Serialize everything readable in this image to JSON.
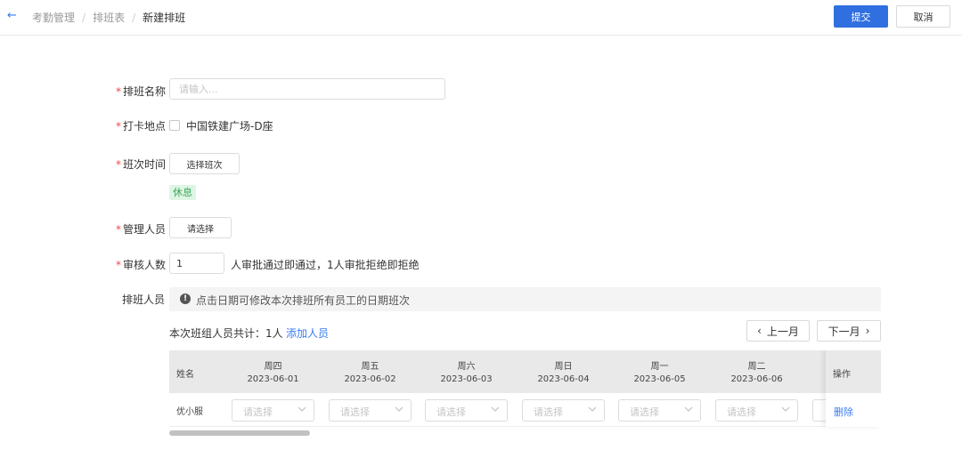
{
  "header": {
    "back_icon": "arrow-left-icon",
    "breadcrumb": [
      "考勤管理",
      "排班表",
      "新建排班"
    ],
    "separator": "/",
    "submit_label": "提交",
    "cancel_label": "取消",
    "accent": "#2f6fe0"
  },
  "form": {
    "required_mark": "*",
    "name": {
      "label": "排班名称",
      "placeholder": "请输入..."
    },
    "location": {
      "label": "打卡地点",
      "option": "中国铁建广场-D座",
      "checked": false
    },
    "shift_time": {
      "label": "班次时间",
      "button": "选择班次",
      "tag": "休息"
    },
    "manager": {
      "label": "管理人员",
      "button": "请选择"
    },
    "reviewers": {
      "label": "审核人数",
      "value": "1",
      "suffix": "人审批通过即通过，1人审批拒绝即拒绝"
    },
    "staff": {
      "label": "排班人员",
      "notice": "点击日期可修改本次排班所有员工的日期班次",
      "count_text": "本次班组人员共计：1人",
      "add_link": "添加人员",
      "prev_month": "上一月",
      "next_month": "下一月"
    }
  },
  "table": {
    "name_header": "姓名",
    "op_header": "操作",
    "days": [
      {
        "weekday": "周四",
        "date": "2023-06-01"
      },
      {
        "weekday": "周五",
        "date": "2023-06-02"
      },
      {
        "weekday": "周六",
        "date": "2023-06-03"
      },
      {
        "weekday": "周日",
        "date": "2023-06-04"
      },
      {
        "weekday": "周一",
        "date": "2023-06-05"
      },
      {
        "weekday": "周二",
        "date": "2023-06-06"
      }
    ],
    "rows": [
      {
        "name": "优小服",
        "select_placeholder": "请选择",
        "action": "删除"
      }
    ]
  }
}
